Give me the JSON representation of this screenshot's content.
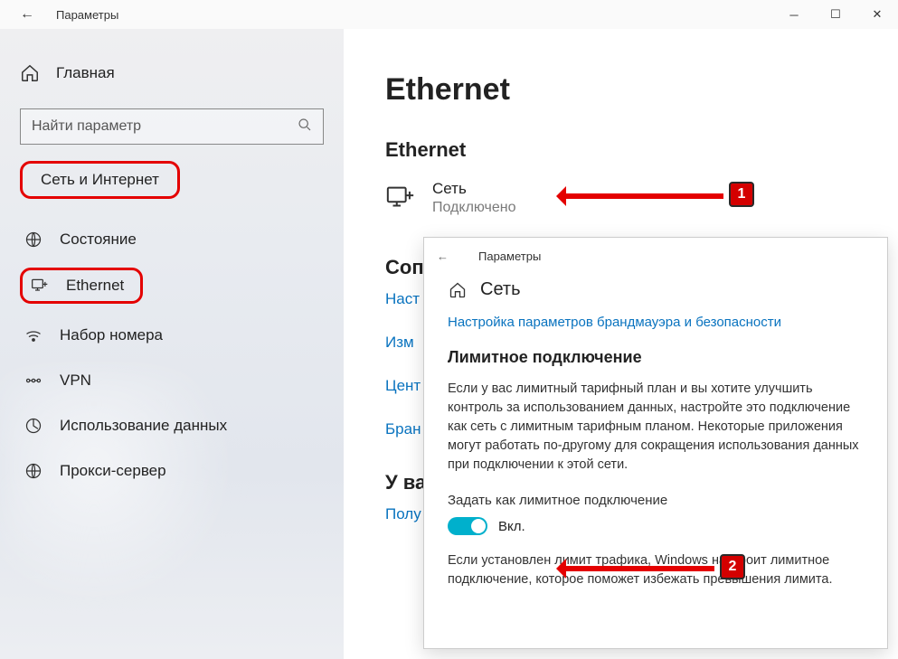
{
  "titlebar": {
    "title": "Параметры"
  },
  "sidebar": {
    "home": "Главная",
    "search_placeholder": "Найти параметр",
    "category": "Сеть и Интернет",
    "items": [
      {
        "label": "Состояние"
      },
      {
        "label": "Ethernet"
      },
      {
        "label": "Набор номера"
      },
      {
        "label": "VPN"
      },
      {
        "label": "Использование данных"
      },
      {
        "label": "Прокси-сервер"
      }
    ]
  },
  "content": {
    "page_title": "Ethernet",
    "section_ethernet": "Ethernet",
    "network": {
      "name": "Сеть",
      "status": "Подключено"
    },
    "related_header": "Соп",
    "links": [
      "Наст",
      "Изм",
      "Цент",
      "Бран"
    ],
    "questions_header": "У ва",
    "questions_link": "Полу"
  },
  "overlay": {
    "title": "Параметры",
    "home": "Сеть",
    "firewall_link": "Настройка параметров брандмауэра и безопасности",
    "metered_header": "Лимитное подключение",
    "metered_desc": "Если у вас лимитный тарифный план и вы хотите улучшить контроль за использованием данных, настройте это подключение как сеть с лимитным тарифным планом. Некоторые приложения могут работать по-другому для сокращения использования данных при подключении к этой сети.",
    "toggle_label": "Задать как лимитное подключение",
    "toggle_state": "Вкл.",
    "limit_desc": "Если установлен лимит трафика, Windows настроит лимитное подключение, которое поможет избежать превышения лимита."
  },
  "annotations": {
    "badge1": "1",
    "badge2": "2"
  }
}
